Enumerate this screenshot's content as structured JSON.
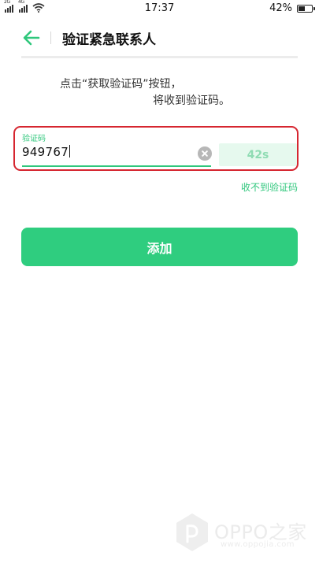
{
  "status_bar": {
    "sim1_network": "2G",
    "sim2_network": "4G",
    "time": "17:37",
    "battery_percent_text": "42%",
    "battery_level": 0.42
  },
  "header": {
    "title": "验证紧急联系人",
    "back_icon": "arrow-left-icon"
  },
  "instruction": {
    "line1": "点击“获取验证码”按钮，",
    "line2": "将收到验证码。"
  },
  "verification": {
    "label": "验证码",
    "value": "949767",
    "clear_icon": "clear-icon",
    "countdown": "42s",
    "resend_label": "收不到验证码"
  },
  "actions": {
    "add_label": "添加"
  },
  "watermark": {
    "brand": "OPPO之家",
    "url": "www.oppojia.com"
  },
  "colors": {
    "accent": "#2fc77c",
    "button": "#2fcd7f",
    "highlight": "#d62630",
    "countdown_bg": "#e6f9ee"
  }
}
